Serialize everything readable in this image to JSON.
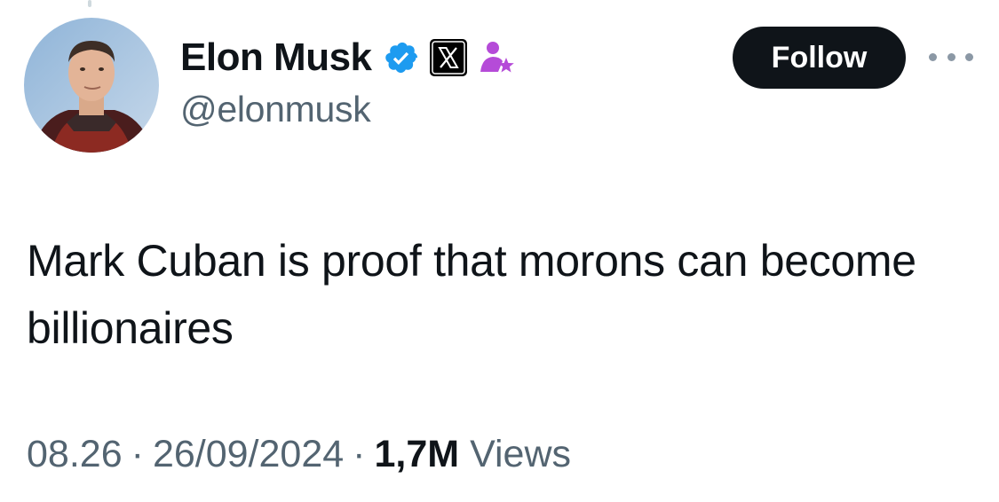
{
  "author": {
    "display_name": "Elon Musk",
    "handle": "@elonmusk",
    "avatar": "profile-photo",
    "badges": [
      "verified-badge-icon",
      "x-affiliate-logo-icon",
      "subscriber-person-star-icon"
    ]
  },
  "actions": {
    "follow_label": "Follow",
    "more_icon": "more-horizontal-icon"
  },
  "tweet": {
    "text": "Mark Cuban is proof that morons can become billionaires",
    "time": "08.26",
    "date": "26/09/2024",
    "separator": "·",
    "views_count": "1,7M",
    "views_label": "Views"
  },
  "colors": {
    "text_primary": "#0f1419",
    "text_secondary": "#536471",
    "verified_blue": "#1d9bf0",
    "subscriber_purple": "#b54bd8",
    "button_bg": "#0f1419"
  }
}
